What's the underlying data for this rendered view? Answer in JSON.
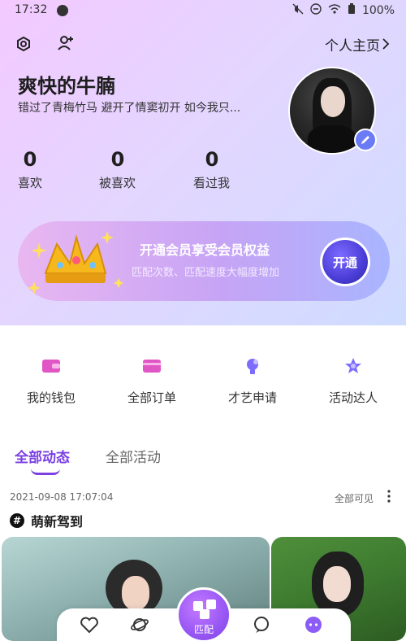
{
  "status_bar": {
    "time": "17:32",
    "battery": "100%"
  },
  "header": {
    "profile_link": "个人主页"
  },
  "user": {
    "name": "爽快的牛腩",
    "bio": "错过了青梅竹马 避开了情窦初开 如今我只..."
  },
  "stats": [
    {
      "value": "0",
      "label": "喜欢"
    },
    {
      "value": "0",
      "label": "被喜欢"
    },
    {
      "value": "0",
      "label": "看过我"
    }
  ],
  "vip_banner": {
    "title": "开通会员享受会员权益",
    "subtitle": "匹配次数、匹配速度大幅度增加",
    "button": "开通"
  },
  "quick_actions": [
    {
      "label": "我的钱包",
      "icon": "wallet-icon",
      "color": "#e056c5"
    },
    {
      "label": "全部订单",
      "icon": "orders-icon",
      "color": "#e056c5"
    },
    {
      "label": "才艺申请",
      "icon": "talent-icon",
      "color": "#7c6bff"
    },
    {
      "label": "活动达人",
      "icon": "star-icon",
      "color": "#7c6bff"
    }
  ],
  "tabs": [
    {
      "label": "全部动态",
      "active": true
    },
    {
      "label": "全部活动",
      "active": false
    }
  ],
  "post": {
    "date": "2021-09-08 17:07:04",
    "visibility": "全部可见",
    "topic": "萌新驾到"
  },
  "bottom_nav": {
    "match_label": "匹配"
  },
  "colors": {
    "accent": "#7b3fe4",
    "vip_button": "#4a3dd6"
  }
}
